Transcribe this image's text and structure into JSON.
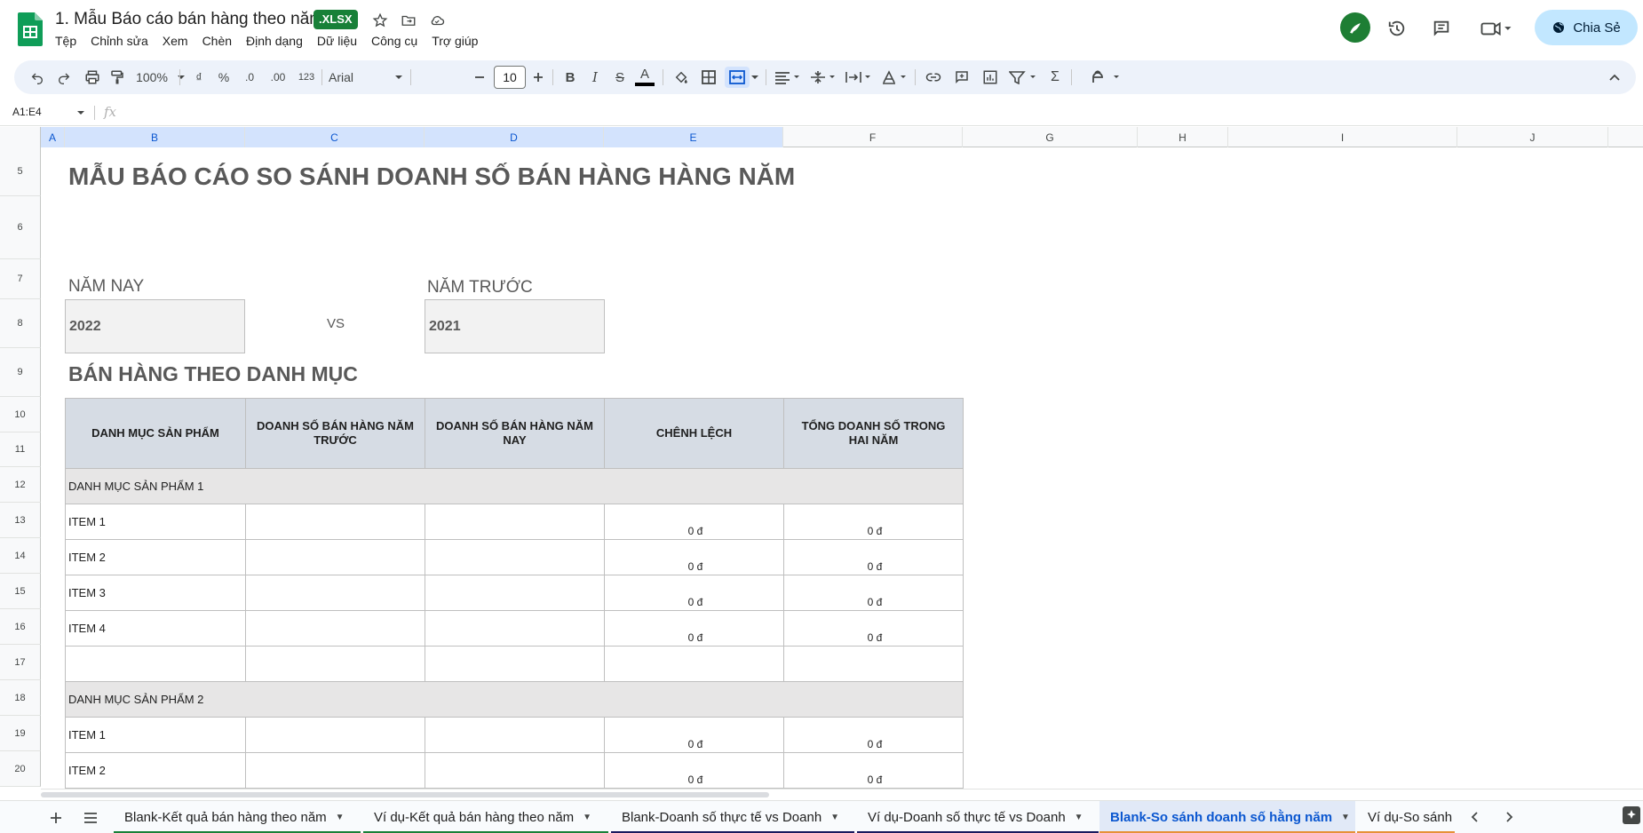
{
  "title_bar": {
    "doc_title": "1. Mẫu Báo cáo bán hàng theo năm",
    "badge": ".XLSX",
    "share_label": "Chia Sẻ"
  },
  "menu": [
    "Tệp",
    "Chỉnh sửa",
    "Xem",
    "Chèn",
    "Định dạng",
    "Dữ liệu",
    "Công cụ",
    "Trợ giúp"
  ],
  "toolbar": {
    "zoom": "100%",
    "currency": "₫",
    "percent": "%",
    "decrease_decimal": ".0",
    "increase_decimal": ".00",
    "number_format": "123",
    "font": "Arial",
    "font_size": "10",
    "bold": "B",
    "italic": "I",
    "strike": "S",
    "text_color": "A",
    "sum": "Σ"
  },
  "formula_bar": {
    "name_box": "A1:E4",
    "fx": "fx"
  },
  "columns": [
    "A",
    "B",
    "C",
    "D",
    "E",
    "F",
    "G",
    "H",
    "I",
    "J"
  ],
  "rows": [
    "5",
    "6",
    "7",
    "8",
    "9",
    "10",
    "11",
    "12",
    "13",
    "14",
    "15",
    "16",
    "17",
    "18",
    "19",
    "20"
  ],
  "sheet": {
    "main_title": "MẪU BÁO CÁO SO SÁNH DOANH SỐ BÁN HÀNG HÀNG NĂM",
    "this_year_label": "NĂM NAY",
    "last_year_label": "NĂM TRƯỚC",
    "this_year": "2022",
    "last_year": "2021",
    "vs": "VS",
    "section_title": "BÁN HÀNG THEO DANH MỤC",
    "table_headers": [
      "DANH MỤC SẢN PHẨM",
      "DOANH SỐ BÁN HÀNG NĂM TRƯỚC",
      "DOANH SỐ BÁN HÀNG NĂM NAY",
      "CHÊNH LỆCH",
      "TỔNG  DOANH SỐ TRONG HAI NĂM"
    ],
    "category_1": "DANH MỤC SẢN PHẨM 1",
    "category_2": "DANH MỤC SẢN PHẨM 2",
    "items": [
      "ITEM 1",
      "ITEM 2",
      "ITEM 3",
      "ITEM 4",
      "ITEM 1",
      "ITEM 2"
    ],
    "zero_value": "0 đ"
  },
  "tabs": [
    {
      "label": "Blank-Kết quả bán hàng theo năm",
      "color": "#188038"
    },
    {
      "label": "Ví dụ-Kết quả bán hàng theo năm",
      "color": "#188038"
    },
    {
      "label": "Blank-Doanh số thực tế vs Doanh",
      "color": "#1a1a5e"
    },
    {
      "label": "Ví dụ-Doanh số thực tế vs Doanh",
      "color": "#1a1a5e"
    },
    {
      "label": "Blank-So sánh doanh số hằng năm",
      "color": "#e69138"
    },
    {
      "label": "Ví dụ-So sánh",
      "color": "#e69138"
    }
  ],
  "colors": {
    "accent": "#0b57d0",
    "sheets_green": "#188038",
    "header_fill": "#d6dce4",
    "category_fill": "#e7e6e6"
  }
}
